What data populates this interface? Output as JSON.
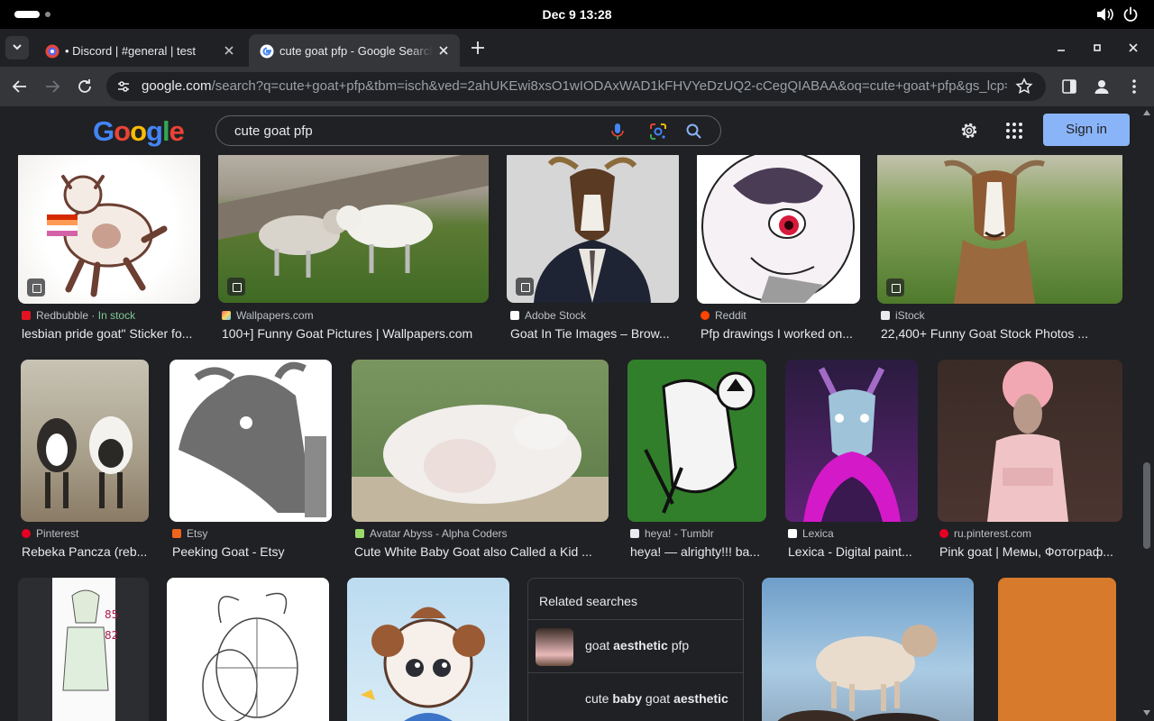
{
  "system": {
    "clock": "Dec 9  13:28"
  },
  "tabs": [
    {
      "title": "• Discord | #general | test",
      "active": false
    },
    {
      "title": "cute goat pfp - Google Search",
      "active": true
    }
  ],
  "toolbar": {
    "url_host": "google.com",
    "url_path": "/search?q=cute+goat+pfp&tbm=isch&ved=2ahUKEwi8xsO1wIODAxWAD1kFHVYeDzUQ2-cCegQIABAA&oq=cute+goat+pfp&gs_lcp=C..."
  },
  "google": {
    "logo": "Google",
    "query": "cute goat pfp",
    "signin": "Sign in"
  },
  "results_row1": [
    {
      "source": "Redbubble",
      "stock": "In stock",
      "caption": "lesbian pride goat\" Sticker fo..."
    },
    {
      "source": "Wallpapers.com",
      "caption": "100+] Funny Goat Pictures | Wallpapers.com"
    },
    {
      "source": "Adobe Stock",
      "caption": "Goat In Tie Images – Brow..."
    },
    {
      "source": "Reddit",
      "caption": "Pfp drawings I worked on..."
    },
    {
      "source": "iStock",
      "caption": "22,400+ Funny Goat Stock Photos ..."
    }
  ],
  "results_row2": [
    {
      "source": "Pinterest",
      "caption": "Rebeka Pancza (reb..."
    },
    {
      "source": "Etsy",
      "caption": "Peeking Goat - Etsy"
    },
    {
      "source": "Avatar Abyss - Alpha Coders",
      "caption": "Cute White Baby Goat also Called a Kid ..."
    },
    {
      "source": "heya! - Tumblr",
      "caption": "heya! — alrighty!!! ba..."
    },
    {
      "source": "Lexica",
      "caption": "Lexica - Digital paint..."
    },
    {
      "source": "ru.pinterest.com",
      "caption": "Pink goat | Мемы, Фотограф..."
    }
  ],
  "related": {
    "title": "Related searches",
    "items": [
      {
        "pre": "goat ",
        "bold": "aesthetic",
        "post": " pfp"
      },
      {
        "pre": "cute ",
        "bold": "baby",
        "mid": " goat ",
        "bold2": "aesthetic"
      }
    ]
  },
  "colors": {
    "accent": "#8ab4f8",
    "bg": "#202124",
    "toolbar": "#35363a",
    "stock": "#81c995"
  }
}
